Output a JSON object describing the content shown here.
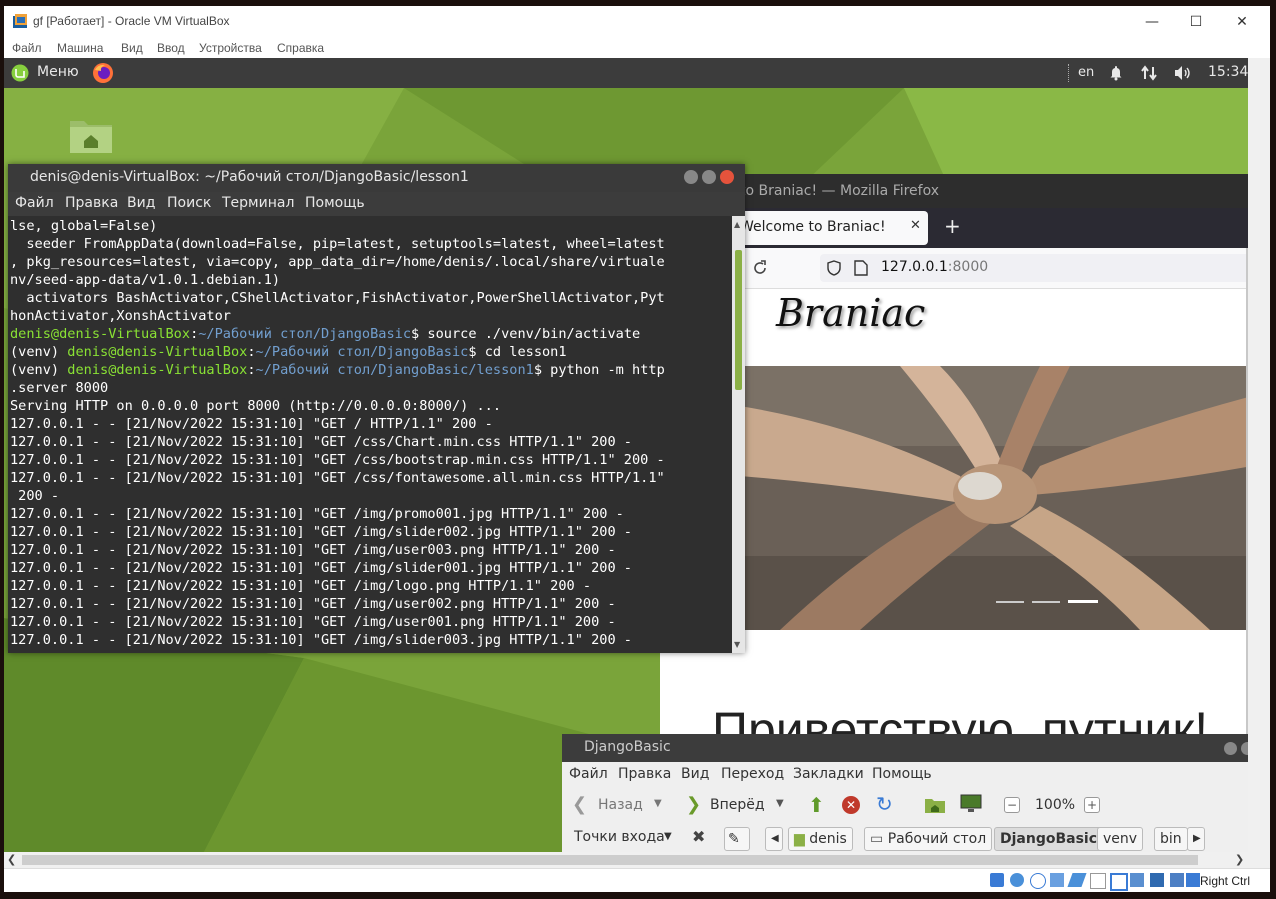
{
  "host_window": {
    "title": "gf [Работает] - Oracle VM VirtualBox",
    "minimize": "—",
    "maximize": "☐",
    "close": "✕",
    "menu": [
      "Файл",
      "Машина",
      "Вид",
      "Ввод",
      "Устройства",
      "Справка"
    ],
    "status_right_ctrl": "Right Ctrl"
  },
  "guest_panel": {
    "menu_label": "Меню",
    "keyboard_layout": "en",
    "clock": "15:34"
  },
  "terminal": {
    "title": "denis@denis-VirtualBox: ~/Рабочий стол/DjangoBasic/lesson1",
    "menu": [
      "Файл",
      "Правка",
      "Вид",
      "Поиск",
      "Терминал",
      "Помощь"
    ],
    "lines": [
      {
        "parts": [
          {
            "t": "lse, global=False)",
            "c": ""
          }
        ]
      },
      {
        "parts": [
          {
            "t": "  seeder FromAppData(download=False, pip=latest, setuptools=latest, wheel=latest",
            "c": ""
          }
        ]
      },
      {
        "parts": [
          {
            "t": ", pkg_resources=latest, via=copy, app_data_dir=/home/denis/.local/share/virtuale",
            "c": ""
          }
        ]
      },
      {
        "parts": [
          {
            "t": "nv/seed-app-data/v1.0.1.debian.1)",
            "c": ""
          }
        ]
      },
      {
        "parts": [
          {
            "t": "  activators BashActivator,CShellActivator,FishActivator,PowerShellActivator,Pyt",
            "c": ""
          }
        ]
      },
      {
        "parts": [
          {
            "t": "honActivator,XonshActivator",
            "c": ""
          }
        ]
      },
      {
        "parts": [
          {
            "t": "denis@denis-VirtualBox",
            "c": "g"
          },
          {
            "t": ":",
            "c": ""
          },
          {
            "t": "~/Рабочий стол/DjangoBasic",
            "c": "b"
          },
          {
            "t": "$ source ./venv/bin/activate",
            "c": ""
          }
        ]
      },
      {
        "parts": [
          {
            "t": "(venv) ",
            "c": ""
          },
          {
            "t": "denis@denis-VirtualBox",
            "c": "g"
          },
          {
            "t": ":",
            "c": ""
          },
          {
            "t": "~/Рабочий стол/DjangoBasic",
            "c": "b"
          },
          {
            "t": "$ cd lesson1",
            "c": ""
          }
        ]
      },
      {
        "parts": [
          {
            "t": "(venv) ",
            "c": ""
          },
          {
            "t": "denis@denis-VirtualBox",
            "c": "g"
          },
          {
            "t": ":",
            "c": ""
          },
          {
            "t": "~/Рабочий стол/DjangoBasic/lesson1",
            "c": "b"
          },
          {
            "t": "$ python -m http",
            "c": ""
          }
        ]
      },
      {
        "parts": [
          {
            "t": ".server 8000",
            "c": ""
          }
        ]
      },
      {
        "parts": [
          {
            "t": "Serving HTTP on 0.0.0.0 port 8000 (http://0.0.0.0:8000/) ...",
            "c": ""
          }
        ]
      },
      {
        "parts": [
          {
            "t": "127.0.0.1 - - [21/Nov/2022 15:31:10] \"GET / HTTP/1.1\" 200 -",
            "c": ""
          }
        ]
      },
      {
        "parts": [
          {
            "t": "127.0.0.1 - - [21/Nov/2022 15:31:10] \"GET /css/Chart.min.css HTTP/1.1\" 200 -",
            "c": ""
          }
        ]
      },
      {
        "parts": [
          {
            "t": "127.0.0.1 - - [21/Nov/2022 15:31:10] \"GET /css/bootstrap.min.css HTTP/1.1\" 200 -",
            "c": ""
          }
        ]
      },
      {
        "parts": [
          {
            "t": "127.0.0.1 - - [21/Nov/2022 15:31:10] \"GET /css/fontawesome.all.min.css HTTP/1.1\"",
            "c": ""
          }
        ]
      },
      {
        "parts": [
          {
            "t": " 200 -",
            "c": ""
          }
        ]
      },
      {
        "parts": [
          {
            "t": "127.0.0.1 - - [21/Nov/2022 15:31:10] \"GET /img/promo001.jpg HTTP/1.1\" 200 -",
            "c": ""
          }
        ]
      },
      {
        "parts": [
          {
            "t": "127.0.0.1 - - [21/Nov/2022 15:31:10] \"GET /img/slider002.jpg HTTP/1.1\" 200 -",
            "c": ""
          }
        ]
      },
      {
        "parts": [
          {
            "t": "127.0.0.1 - - [21/Nov/2022 15:31:10] \"GET /img/user003.png HTTP/1.1\" 200 -",
            "c": ""
          }
        ]
      },
      {
        "parts": [
          {
            "t": "127.0.0.1 - - [21/Nov/2022 15:31:10] \"GET /img/slider001.jpg HTTP/1.1\" 200 -",
            "c": ""
          }
        ]
      },
      {
        "parts": [
          {
            "t": "127.0.0.1 - - [21/Nov/2022 15:31:10] \"GET /img/logo.png HTTP/1.1\" 200 -",
            "c": ""
          }
        ]
      },
      {
        "parts": [
          {
            "t": "127.0.0.1 - - [21/Nov/2022 15:31:10] \"GET /img/user002.png HTTP/1.1\" 200 -",
            "c": ""
          }
        ]
      },
      {
        "parts": [
          {
            "t": "127.0.0.1 - - [21/Nov/2022 15:31:10] \"GET /img/user001.png HTTP/1.1\" 200 -",
            "c": ""
          }
        ]
      },
      {
        "parts": [
          {
            "t": "127.0.0.1 - - [21/Nov/2022 15:31:10] \"GET /img/slider003.jpg HTTP/1.1\" 200 -",
            "c": ""
          }
        ]
      }
    ]
  },
  "firefox": {
    "window_title": "to Braniac! — Mozilla Firefox",
    "tab_title": "Welcome to Braniac!",
    "tab_close": "✕",
    "new_tab": "+",
    "url_host": "127.0.0.1",
    "url_port": ":8000",
    "logo_text": "Braniac",
    "heading": "Приветствую, путник!"
  },
  "nemo": {
    "title": "DjangoBasic",
    "menu": [
      "Файл",
      "Правка",
      "Вид",
      "Переход",
      "Закладки",
      "Помощь"
    ],
    "back_label": "Назад",
    "forward_label": "Вперёд",
    "zoom": "100%",
    "places_label": "Точки входа",
    "crumbs": [
      "denis",
      "Рабочий стол",
      "DjangoBasic",
      "venv",
      "bin"
    ]
  }
}
